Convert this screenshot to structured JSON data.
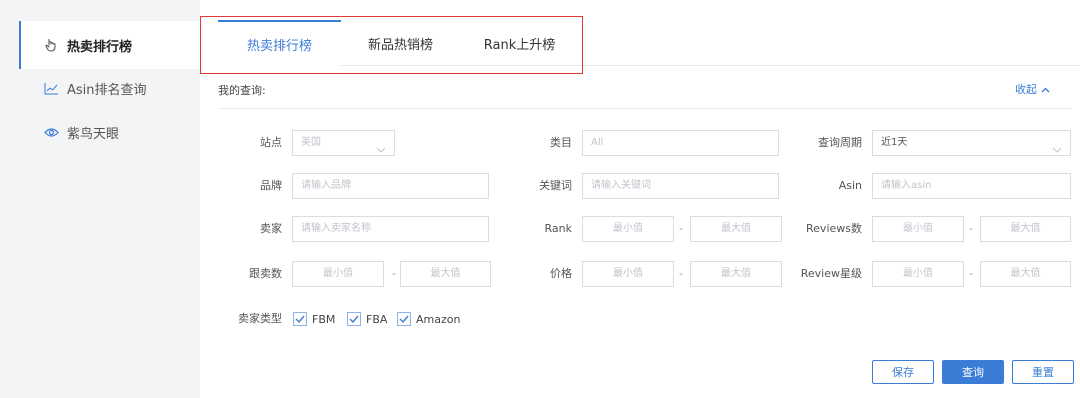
{
  "sidebar": {
    "items": [
      {
        "label": "热卖排行榜",
        "icon": "hand-pointer-icon"
      },
      {
        "label": "Asin排名查询",
        "icon": "line-chart-icon"
      },
      {
        "label": "紫鸟天眼",
        "icon": "eye-icon"
      }
    ]
  },
  "tabs": [
    {
      "label": "热卖排行榜",
      "active": true
    },
    {
      "label": "新品热销榜",
      "active": false
    },
    {
      "label": "Rank上升榜",
      "active": false
    }
  ],
  "query": {
    "title": "我的查询:",
    "collapse_label": "收起"
  },
  "form": {
    "site": {
      "label": "站点",
      "value": "美国"
    },
    "category": {
      "label": "类目",
      "value": "All"
    },
    "period": {
      "label": "查询周期",
      "value": "近1天"
    },
    "brand": {
      "label": "品牌",
      "placeholder": "请输入品牌"
    },
    "keyword": {
      "label": "关键词",
      "placeholder": "请输入关键词"
    },
    "asin": {
      "label": "Asin",
      "placeholder": "请输入asin"
    },
    "seller": {
      "label": "卖家",
      "placeholder": "请输入卖家名称"
    },
    "rank": {
      "label": "Rank",
      "min": "最小值",
      "max": "最大值"
    },
    "reviews": {
      "label": "Reviews数",
      "min": "最小值",
      "max": "最大值"
    },
    "follow": {
      "label": "跟卖数",
      "min": "最小值",
      "max": "最大值"
    },
    "price": {
      "label": "价格",
      "min": "最小值",
      "max": "最大值"
    },
    "rating": {
      "label": "Review星级",
      "min": "最小值",
      "max": "最大值"
    },
    "seller_type": {
      "label": "卖家类型",
      "options": [
        {
          "label": "FBM",
          "checked": true
        },
        {
          "label": "FBA",
          "checked": true
        },
        {
          "label": "Amazon",
          "checked": true
        }
      ]
    },
    "range_sep": "-"
  },
  "buttons": {
    "save": "保存",
    "search": "查询",
    "reset": "重置"
  },
  "colors": {
    "accent": "#3b7cd6",
    "highlight": "#e23a3a",
    "sidebar_bg": "#f3f4f6"
  }
}
